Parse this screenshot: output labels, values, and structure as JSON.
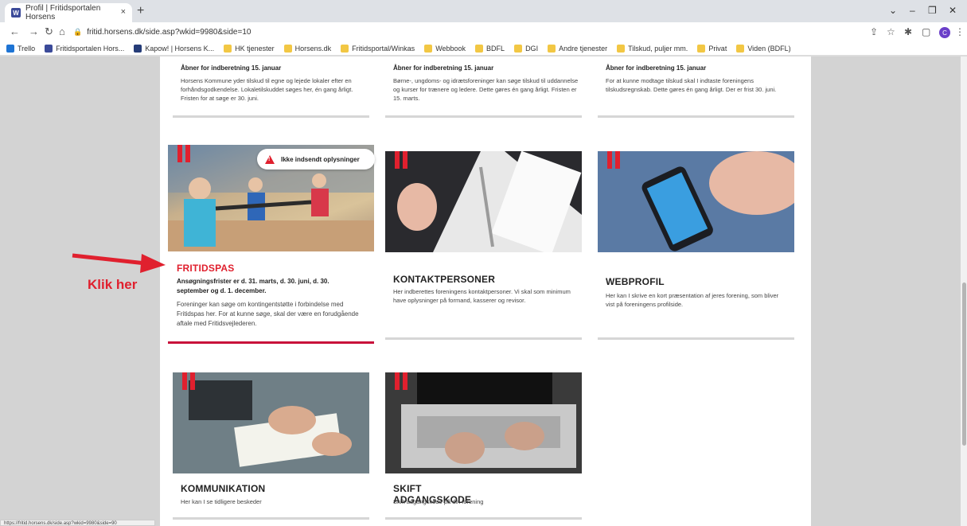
{
  "browser": {
    "tab_title": "Profil | Fritidsportalen Horsens",
    "tab_close": "×",
    "new_tab": "+",
    "url": "fritid.horsens.dk/side.asp?wkid=9980&side=10",
    "status_url": "https://fritid.horsens.dk/side.asp?wkid=9980&side=90",
    "avatar_letter": "C",
    "bookmarks": [
      "Trello",
      "Fritidsportalen Hors...",
      "Kapow! | Horsens K...",
      "HK tjenester",
      "Horsens.dk",
      "Fritidsportal/Winkas",
      "Webbook",
      "BDFL",
      "DGI",
      "Andre tjenester",
      "Tilskud, puljer mm.",
      "Privat",
      "Viden (BDFL)"
    ]
  },
  "top_cards": [
    {
      "heading": "Åbner for indberetning 15. januar",
      "desc": "Horsens Kommune yder tilskud til egne og lejede lokaler efter en forhåndsgodkendelse. Lokaletilskuddet søges her, én gang årligt. Fristen for at søge er 30. juni."
    },
    {
      "heading": "Åbner for indberetning 15. januar",
      "desc": "Børne-, ungdoms- og idrætsforeninger kan søge tilskud til uddannelse og kurser for trænere og ledere. Dette gøres én gang årligt. Fristen er 15. marts."
    },
    {
      "heading": "Åbner for indberetning 15. januar",
      "desc": "For at kunne modtage tilskud skal I indtaste foreningens tilskudsregnskab. Dette gøres én gang årligt. Der er frist 30. juni."
    }
  ],
  "cards": [
    {
      "title": "FRITIDSPAS",
      "sub": "Ansøgningsfrister er d. 31. marts, d. 30. juni, d. 30. september og d. 1. december.",
      "desc": "Foreninger kan søge om kontingentstøtte i forbindelse med Fritidspas her. For at kunne søge, skal der være en forudgående aftale med Fritidsvejlederen.",
      "badge": "Ikke indsendt oplysninger"
    },
    {
      "title": "KONTAKTPERSONER",
      "desc": "Her indberettes foreningens kontaktpersoner. Vi skal som minimum have oplysninger på formand, kasserer og revisor."
    },
    {
      "title": "WEBPROFIL",
      "desc": "Her kan I skrive en kort præsentation af jeres forening, som bliver vist på foreningens profilside."
    },
    {
      "title": "KOMMUNIKATION",
      "desc": "Her kan I se tidligere beskeder"
    },
    {
      "title": "SKIFT ADGANGSKODE",
      "desc": "Skift adgangskode på din forening"
    }
  ],
  "annotation": {
    "label": "Klik her"
  },
  "colors": {
    "accent_red": "#e0202e",
    "divider_red": "#c8103a"
  }
}
